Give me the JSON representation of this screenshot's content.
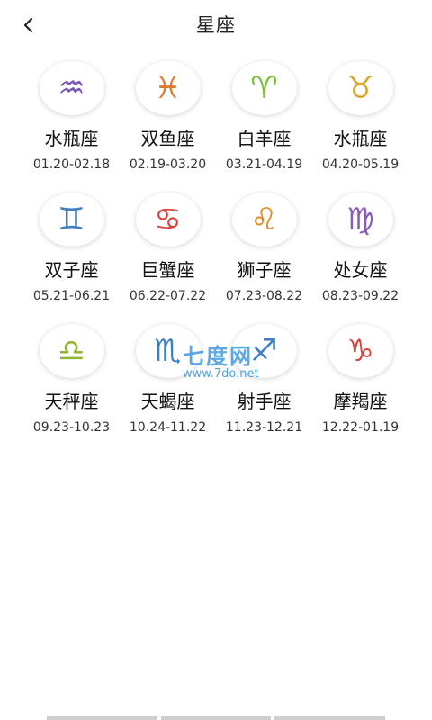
{
  "header": {
    "title": "星座",
    "back_icon": "chevron-left-icon"
  },
  "zodiac": [
    {
      "name": "水瓶座",
      "date": "01.20-02.18",
      "icon": "aquarius-icon",
      "color": "#7a56b8"
    },
    {
      "name": "双鱼座",
      "date": "02.19-03.20",
      "icon": "pisces-icon",
      "color": "#e07a2a"
    },
    {
      "name": "白羊座",
      "date": "03.21-04.19",
      "icon": "aries-icon",
      "color": "#7fbf3a"
    },
    {
      "name": "水瓶座",
      "date": "04.20-05.19",
      "icon": "taurus-icon",
      "color": "#d4a62a"
    },
    {
      "name": "双子座",
      "date": "05.21-06.21",
      "icon": "gemini-icon",
      "color": "#3d7fc4"
    },
    {
      "name": "巨蟹座",
      "date": "06.22-07.22",
      "icon": "cancer-icon",
      "color": "#d8443c"
    },
    {
      "name": "狮子座",
      "date": "07.23-08.22",
      "icon": "leo-icon",
      "color": "#e08a22"
    },
    {
      "name": "处女座",
      "date": "08.23-09.22",
      "icon": "virgo-icon",
      "color": "#8a5ab8"
    },
    {
      "name": "天秤座",
      "date": "09.23-10.23",
      "icon": "libra-icon",
      "color": "#8fb62e"
    },
    {
      "name": "天蝎座",
      "date": "10.24-11.22",
      "icon": "scorpio-icon",
      "color": "#3d7fc4"
    },
    {
      "name": "射手座",
      "date": "11.23-12.21",
      "icon": "sagittarius-icon",
      "color": "#3d7fc4"
    },
    {
      "name": "摩羯座",
      "date": "12.22-01.19",
      "icon": "capricorn-icon",
      "color": "#d8443c"
    }
  ],
  "watermark": {
    "text": "七度网",
    "url": "www.7do.net"
  }
}
